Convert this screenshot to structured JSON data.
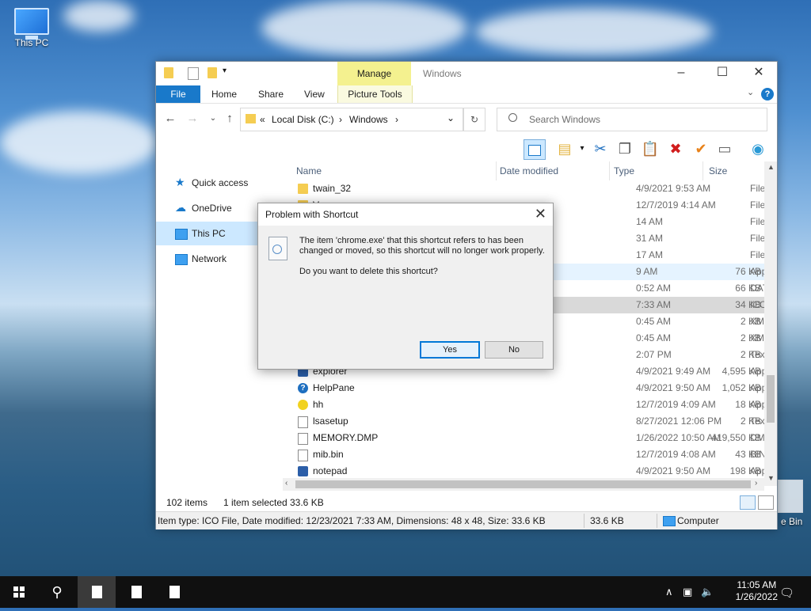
{
  "desktop": {
    "this_pc_label": "This PC",
    "bin_label": "e Bin"
  },
  "window": {
    "title": "Windows",
    "manage_tab": "Manage",
    "tabs": {
      "file": "File",
      "home": "Home",
      "share": "Share",
      "view": "View",
      "picture_tools": "Picture Tools"
    },
    "address": {
      "prefix": "«",
      "crumb1": "Local Disk (C:)",
      "sep1": "›",
      "crumb2": "Windows",
      "sep2": "›"
    },
    "search_placeholder": "Search Windows",
    "nav": {
      "quick_access": "Quick access",
      "onedrive": "OneDrive",
      "this_pc": "This PC",
      "network": "Network"
    },
    "columns": {
      "name": "Name",
      "date": "Date modified",
      "type": "Type",
      "size": "Size"
    },
    "files": [
      {
        "name": "twain_32",
        "date": "4/9/2021 9:53 AM",
        "type": "File folder",
        "size": "",
        "icon": "folder"
      },
      {
        "name": "Vss",
        "date": "12/7/2019 4:14 AM",
        "type": "File folder",
        "size": "",
        "icon": "folder"
      },
      {
        "name": "",
        "date": "14 AM",
        "type": "File folder",
        "size": "",
        "icon": "folder"
      },
      {
        "name": "",
        "date": "31 AM",
        "type": "File folder",
        "size": "",
        "icon": "folder"
      },
      {
        "name": "",
        "date": "17 AM",
        "type": "File folder",
        "size": "",
        "icon": "folder"
      },
      {
        "name": "",
        "date": "9 AM",
        "type": "Application",
        "size": "76 KB",
        "icon": "app"
      },
      {
        "name": "",
        "date": "0:52 AM",
        "type": "DAT File",
        "size": "66 KB",
        "icon": "doc"
      },
      {
        "name": "",
        "date": "7:33 AM",
        "type": "ICO File",
        "size": "34 KB",
        "icon": "doc"
      },
      {
        "name": "",
        "date": "0:45 AM",
        "type": "XML Document",
        "size": "2 KB",
        "icon": "doc"
      },
      {
        "name": "",
        "date": "0:45 AM",
        "type": "XML Document",
        "size": "2 KB",
        "icon": "doc"
      },
      {
        "name": "",
        "date": "2:07 PM",
        "type": "Text Document",
        "size": "2 KB",
        "icon": "doc"
      },
      {
        "name": "explorer",
        "date": "4/9/2021 9:49 AM",
        "type": "Application",
        "size": "4,595 KB",
        "icon": "app"
      },
      {
        "name": "HelpPane",
        "date": "4/9/2021 9:50 AM",
        "type": "Application",
        "size": "1,052 KB",
        "icon": "help"
      },
      {
        "name": "hh",
        "date": "12/7/2019 4:09 AM",
        "type": "Application",
        "size": "18 KB",
        "icon": "hh"
      },
      {
        "name": "lsasetup",
        "date": "8/27/2021 12:06 PM",
        "type": "Text Document",
        "size": "2 KB",
        "icon": "doc"
      },
      {
        "name": "MEMORY.DMP",
        "date": "1/26/2022 10:50 AM",
        "type": "DMP File",
        "size": "419,550 KB",
        "icon": "doc"
      },
      {
        "name": "mib.bin",
        "date": "12/7/2019 4:08 AM",
        "type": "BIN File",
        "size": "43 KB",
        "icon": "doc"
      },
      {
        "name": "notepad",
        "date": "4/9/2021 9:50 AM",
        "type": "Application",
        "size": "198 KB",
        "icon": "app"
      }
    ],
    "status": {
      "items": "102 items",
      "selected": "1 item selected",
      "size": "33.6 KB"
    },
    "details": {
      "text": "Item type: ICO File, Date modified: 12/23/2021 7:33 AM, Dimensions: 48 x 48, Size: 33.6 KB",
      "size": "33.6 KB",
      "location": "Computer"
    }
  },
  "dialog": {
    "title": "Problem with Shortcut",
    "message": "The item 'chrome.exe' that this shortcut refers to has been changed or moved, so this shortcut will no longer work properly.",
    "question": "Do you want to delete this shortcut?",
    "yes": "Yes",
    "no": "No"
  },
  "taskbar": {
    "time": "11:05 AM",
    "date": "1/26/2022"
  },
  "colors": {
    "accent": "#1979ca",
    "selection": "#cce8ff",
    "manage": "#f4f18f"
  }
}
